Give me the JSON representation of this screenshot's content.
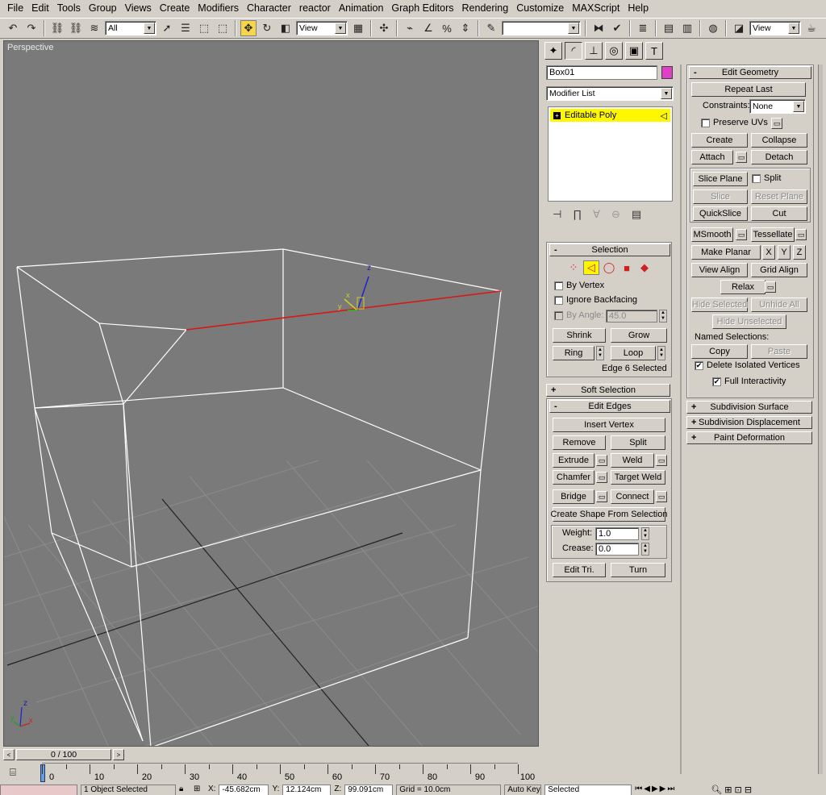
{
  "menu": [
    "File",
    "Edit",
    "Tools",
    "Group",
    "Views",
    "Create",
    "Modifiers",
    "Character",
    "reactor",
    "Animation",
    "Graph Editors",
    "Rendering",
    "Customize",
    "MAXScript",
    "Help"
  ],
  "toolbar": {
    "selection_filter": "All",
    "ref_coord": "View",
    "named_sel_set": "",
    "view_combo": "View"
  },
  "viewport": {
    "label": "Perspective",
    "gizmo_axis_z": "z",
    "gizmo_axis_x": "x",
    "gizmo_axis_y": "y",
    "corner_axis_z": "z",
    "corner_axis_x": "x",
    "corner_axis_y": "y"
  },
  "timeslider": {
    "frame": "0 / 100",
    "prev": "<",
    "next": ">"
  },
  "track_labels": [
    "0",
    "10",
    "20",
    "30",
    "40",
    "50",
    "60",
    "70",
    "80",
    "90",
    "100"
  ],
  "status": {
    "selected": "1 Object Selected",
    "x_label": "X:",
    "x": "-45.682cm",
    "y_label": "Y:",
    "y": "12.124cm",
    "z_label": "Z:",
    "z": "99.091cm",
    "grid": "Grid = 10.0cm",
    "autokey": "Auto Key",
    "key_mode": "Selected"
  },
  "command_panel": {
    "object_name": "Box01",
    "object_color": "#e040c8",
    "modifier_list": "Modifier List",
    "stack_item": "Editable Poly",
    "selection": {
      "title": "Selection",
      "by_vertex": "By Vertex",
      "ignore_backfacing": "Ignore Backfacing",
      "by_angle": "By Angle:",
      "angle_value": "45.0",
      "shrink": "Shrink",
      "grow": "Grow",
      "ring": "Ring",
      "loop": "Loop",
      "status": "Edge 6 Selected"
    },
    "soft_selection": "Soft Selection",
    "edit_edges": {
      "title": "Edit Edges",
      "insert_vertex": "Insert Vertex",
      "remove": "Remove",
      "split": "Split",
      "extrude": "Extrude",
      "weld": "Weld",
      "chamfer": "Chamfer",
      "target_weld": "Target Weld",
      "bridge": "Bridge",
      "connect": "Connect",
      "create_shape": "Create Shape From Selection",
      "weight_label": "Weight:",
      "weight": "1.0",
      "crease_label": "Crease:",
      "crease": "0.0",
      "edit_tri": "Edit Tri.",
      "turn": "Turn"
    },
    "edit_geometry": {
      "title": "Edit Geometry",
      "repeat_last": "Repeat Last",
      "constraints_label": "Constraints:",
      "constraints": "None",
      "preserve_uvs": "Preserve UVs",
      "create": "Create",
      "collapse": "Collapse",
      "attach": "Attach",
      "detach": "Detach",
      "slice_plane": "Slice Plane",
      "split": "Split",
      "slice": "Slice",
      "reset_plane": "Reset Plane",
      "quickslice": "QuickSlice",
      "cut": "Cut",
      "msmooth": "MSmooth",
      "tessellate": "Tessellate",
      "make_planar": "Make Planar",
      "x": "X",
      "y": "Y",
      "z": "Z",
      "view_align": "View Align",
      "grid_align": "Grid Align",
      "relax": "Relax",
      "hide_selected": "Hide Selected",
      "unhide_all": "Unhide All",
      "hide_unselected": "Hide Unselected",
      "named_selections": "Named Selections:",
      "copy": "Copy",
      "paste": "Paste",
      "delete_isolated": "Delete Isolated Vertices",
      "full_interactivity": "Full Interactivity"
    },
    "subdivision_surface": "Subdivision Surface",
    "subdivision_displacement": "Subdivision Displacement",
    "paint_deformation": "Paint Deformation"
  }
}
